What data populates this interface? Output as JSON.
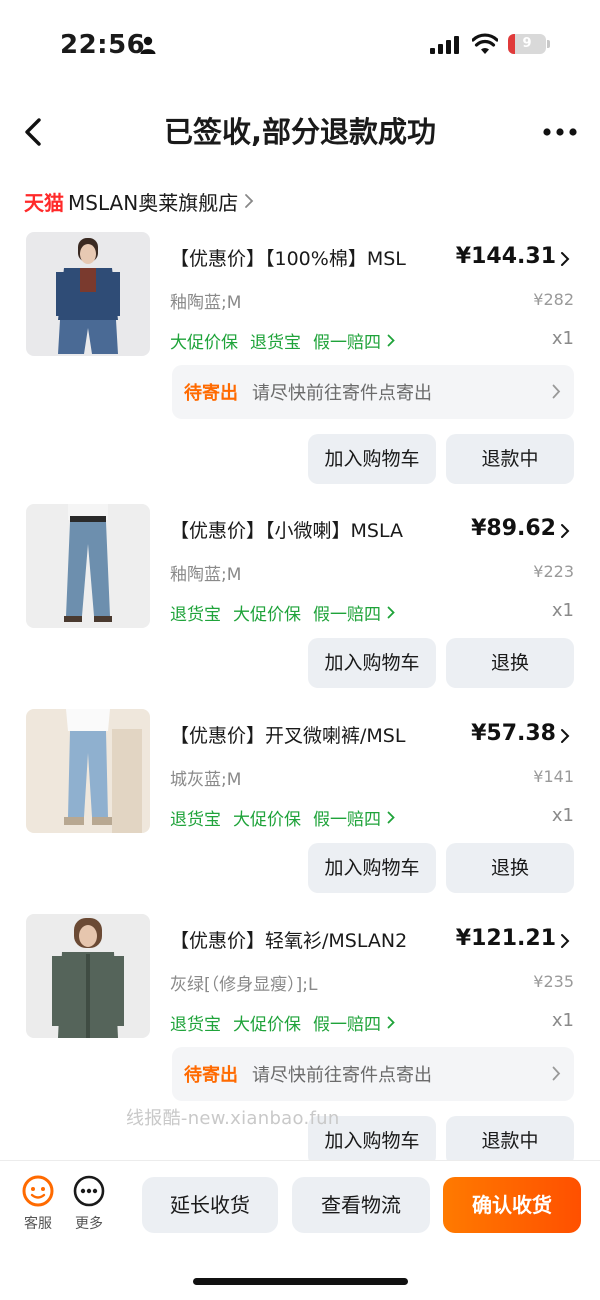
{
  "status_bar": {
    "time": "22:56",
    "battery_level": "9",
    "battery_fraction": 0.09,
    "battery_color": "#e03a3a"
  },
  "nav": {
    "title": "已签收,部分退款成功"
  },
  "shop": {
    "badge": "天猫",
    "name": "MSLAN奥莱旗舰店"
  },
  "products": [
    {
      "title": "【优惠价】【100%棉】MSL",
      "price": "¥144.31",
      "sku": "釉陶蓝;M",
      "original_price": "¥282",
      "tags": [
        "大促价保",
        "退货宝",
        "假一赔四"
      ],
      "qty": "x1",
      "notice": {
        "tag": "待寄出",
        "text": "请尽快前往寄件点寄出"
      },
      "buttons": [
        "加入购物车",
        "退款中"
      ]
    },
    {
      "title": "【优惠价】【小微喇】MSLA",
      "price": "¥89.62",
      "sku": "釉陶蓝;M",
      "original_price": "¥223",
      "tags": [
        "退货宝",
        "大促价保",
        "假一赔四"
      ],
      "qty": "x1",
      "buttons": [
        "加入购物车",
        "退换"
      ]
    },
    {
      "title": "【优惠价】开叉微喇裤/MSL",
      "price": "¥57.38",
      "sku": "城灰蓝;M",
      "original_price": "¥141",
      "tags": [
        "退货宝",
        "大促价保",
        "假一赔四"
      ],
      "qty": "x1",
      "buttons": [
        "加入购物车",
        "退换"
      ]
    },
    {
      "title": "【优惠价】轻氧衫/MSLAN2",
      "price": "¥121.21",
      "sku": "灰绿[（修身显瘦）];L",
      "original_price": "¥235",
      "tags": [
        "退货宝",
        "大促价保",
        "假一赔四"
      ],
      "qty": "x1",
      "notice": {
        "tag": "待寄出",
        "text": "请尽快前往寄件点寄出"
      },
      "buttons": [
        "加入购物车",
        "退款中"
      ]
    }
  ],
  "watermark": "线报酷-new.xianbao.fun",
  "bottom_bar": {
    "service_label": "客服",
    "more_label": "更多",
    "extend_label": "延长收货",
    "logistics_label": "查看物流",
    "confirm_label": "确认收货"
  },
  "colors": {
    "accent": "#ff5000",
    "tmall_red": "#ff2a2a",
    "tag_green": "#1fa33a",
    "notice_orange": "#ff6a00"
  }
}
